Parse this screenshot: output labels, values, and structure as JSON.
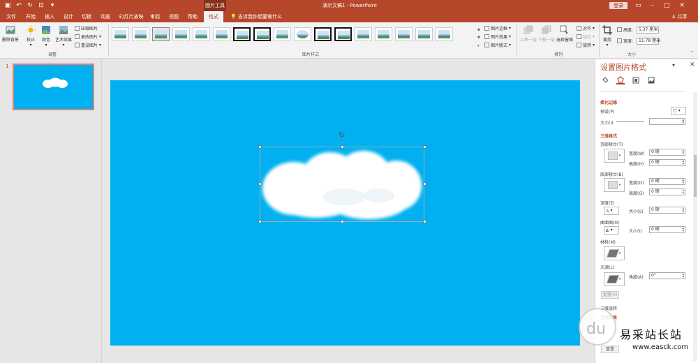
{
  "window": {
    "context_group": "图片工具",
    "doc_title": "演示文稿1 - PowerPoint",
    "login": "登录",
    "qat_icons": [
      "save-icon",
      "undo-icon",
      "redo-icon",
      "present-icon",
      "customize-icon"
    ]
  },
  "tabs": [
    "文件",
    "开始",
    "插入",
    "设计",
    "切换",
    "动画",
    "幻灯片放映",
    "审阅",
    "视图",
    "帮助",
    "格式"
  ],
  "active_tab": "格式",
  "tell_me": "告诉我你想要做什么",
  "share": "共享",
  "ribbon": {
    "adjust": {
      "remove_bg": "删除背景",
      "corrections": "校正",
      "color": "颜色",
      "artistic": "艺术效果",
      "compress": "压缩图片",
      "change": "更改图片",
      "reset": "重设图片",
      "label": "调整"
    },
    "styles_label": "图片样式",
    "border": "图片边框",
    "effects": "图片效果",
    "layout": "图片版式",
    "arrange": {
      "forward": "上移一层",
      "backward": "下移一层",
      "selection": "选择窗格",
      "align": "对齐",
      "group": "组合",
      "rotate": "旋转",
      "label": "排列"
    },
    "size": {
      "crop": "裁剪",
      "height_label": "高度:",
      "height_value": "5.37 厘米",
      "width_label": "宽度:",
      "width_value": "11.78 厘米",
      "label": "大小"
    }
  },
  "slides": {
    "current": "1"
  },
  "pane": {
    "title": "设置图片格式",
    "soft_edges": "柔化边缘",
    "preset": "预设(P)",
    "size": "大小(I)",
    "format3d": "三维格式",
    "top_bevel": "顶部棱台(T)",
    "width": "宽度(W)",
    "height": "高度(H)",
    "bottom_bevel": "底部棱台(B)",
    "width_d": "宽度(D)",
    "height_g": "高度(G)",
    "depth": "深度(E)",
    "depth_size": "大小(S)",
    "contour": "曲面图(O)",
    "contour_size": "大小(I)",
    "material": "材料(M)",
    "lighting": "光源(L)",
    "angle": "角度(A)",
    "reset": "重置(R)",
    "rotation3d": "三维旋转",
    "artistic_effects": "艺术效果",
    "reset2": "重置",
    "zero_pounds": "0 磅",
    "angle_value": "0°"
  },
  "watermark": {
    "brand": "易采站长站",
    "url": "www.easck.com"
  },
  "colors": {
    "accent": "#b7472a",
    "slide_bg": "#00b0f0"
  }
}
